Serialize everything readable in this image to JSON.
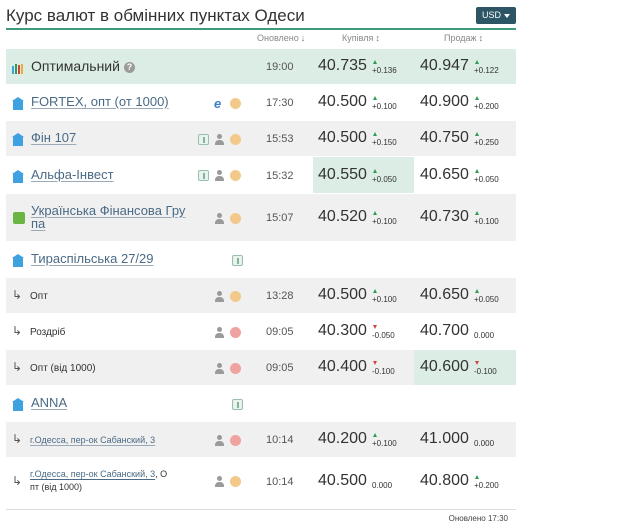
{
  "header": {
    "title": "Курс валют в обмінних пунктах Одеси",
    "currency_button": "USD"
  },
  "columns": {
    "updated": "Оновлено",
    "updated_arrow": "↓",
    "buy": "Купівля",
    "buy_arrow": "↕",
    "sell": "Продаж",
    "sell_arrow": "↕"
  },
  "rows": [
    {
      "kind": "opt",
      "name": "Оптимальний",
      "icon": "optimal-bars-icon",
      "help": "?",
      "time": "19:00",
      "buy": "40.735",
      "buy_dir": "up",
      "buy_delta": "+0.136",
      "sell": "40.947",
      "sell_dir": "up",
      "sell_delta": "+0.122"
    },
    {
      "kind": "bank",
      "name": "FORTEX, опт (от 1000)",
      "icons": [
        "ie",
        "dot-y"
      ],
      "time": "17:30",
      "buy": "40.500",
      "buy_dir": "up",
      "buy_delta": "+0.100",
      "sell": "40.900",
      "sell_dir": "up",
      "sell_delta": "+0.200"
    },
    {
      "kind": "bank",
      "name": "Фін 107",
      "icons": [
        "badge",
        "person",
        "dot-y"
      ],
      "time": "15:53",
      "buy": "40.500",
      "buy_dir": "up",
      "buy_delta": "+0.150",
      "sell": "40.750",
      "sell_dir": "up",
      "sell_delta": "+0.250"
    },
    {
      "kind": "bank",
      "name": "Альфа-Інвест",
      "icons": [
        "badge",
        "person",
        "dot-y"
      ],
      "time": "15:32",
      "buy": "40.550",
      "buy_dir": "up",
      "buy_delta": "+0.050",
      "sell": "40.650",
      "sell_dir": "up",
      "sell_delta": "+0.050",
      "buy_hl": true
    },
    {
      "kind": "bank2",
      "name_line1": "Українська Фінансова Гру",
      "name_line2": "па",
      "icons": [
        "person",
        "dot-y"
      ],
      "time": "15:07",
      "buy": "40.520",
      "buy_dir": "up",
      "buy_delta": "+0.100",
      "sell": "40.730",
      "sell_dir": "up",
      "sell_delta": "+0.100"
    },
    {
      "kind": "group",
      "name": "Тираспільська 27/29",
      "icons": [
        "badge"
      ]
    },
    {
      "kind": "sub",
      "name": "Опт",
      "icons": [
        "person",
        "dot-y"
      ],
      "time": "13:28",
      "buy": "40.500",
      "buy_dir": "up",
      "buy_delta": "+0.100",
      "sell": "40.650",
      "sell_dir": "up",
      "sell_delta": "+0.050"
    },
    {
      "kind": "sub",
      "name": "Роздріб",
      "icons": [
        "person",
        "dot-r"
      ],
      "time": "09:05",
      "buy": "40.300",
      "buy_dir": "down",
      "buy_delta": "-0.050",
      "sell": "40.700",
      "sell_dir": "none",
      "sell_delta": "0.000"
    },
    {
      "kind": "sub",
      "name": "Опт (від 1000)",
      "icons": [
        "person",
        "dot-r"
      ],
      "time": "09:05",
      "buy": "40.400",
      "buy_dir": "down",
      "buy_delta": "-0.100",
      "sell": "40.600",
      "sell_dir": "down",
      "sell_delta": "-0.100",
      "sell_hl": true
    },
    {
      "kind": "group",
      "name": "ANNA",
      "icons": [
        "badge"
      ]
    },
    {
      "kind": "sublink",
      "name": "г.Одесса, пер-ок Сабанский, 3",
      "icons": [
        "person",
        "dot-r"
      ],
      "time": "10:14",
      "buy": "40.200",
      "buy_dir": "up",
      "buy_delta": "+0.100",
      "sell": "41.000",
      "sell_dir": "none",
      "sell_delta": "0.000"
    },
    {
      "kind": "sublink2",
      "name_link": "г.Одесса, пер-ок Сабанский, 3",
      "name_rest1": ", О",
      "name_line2": "пт (від 1000)",
      "icons": [
        "person",
        "dot-y"
      ],
      "time": "10:14",
      "buy": "40.500",
      "buy_dir": "none",
      "buy_delta": "0.000",
      "sell": "40.800",
      "sell_dir": "up",
      "sell_delta": "+0.200"
    }
  ],
  "footer": {
    "updated_text": "Оновлено 17:30"
  },
  "colors": {
    "accent": "#3d9b7c",
    "highlight": "#dcede5",
    "link": "#4a6a86",
    "bank_icon": "#3fa1e0",
    "up": "#2d9c55",
    "down": "#d2453c"
  }
}
